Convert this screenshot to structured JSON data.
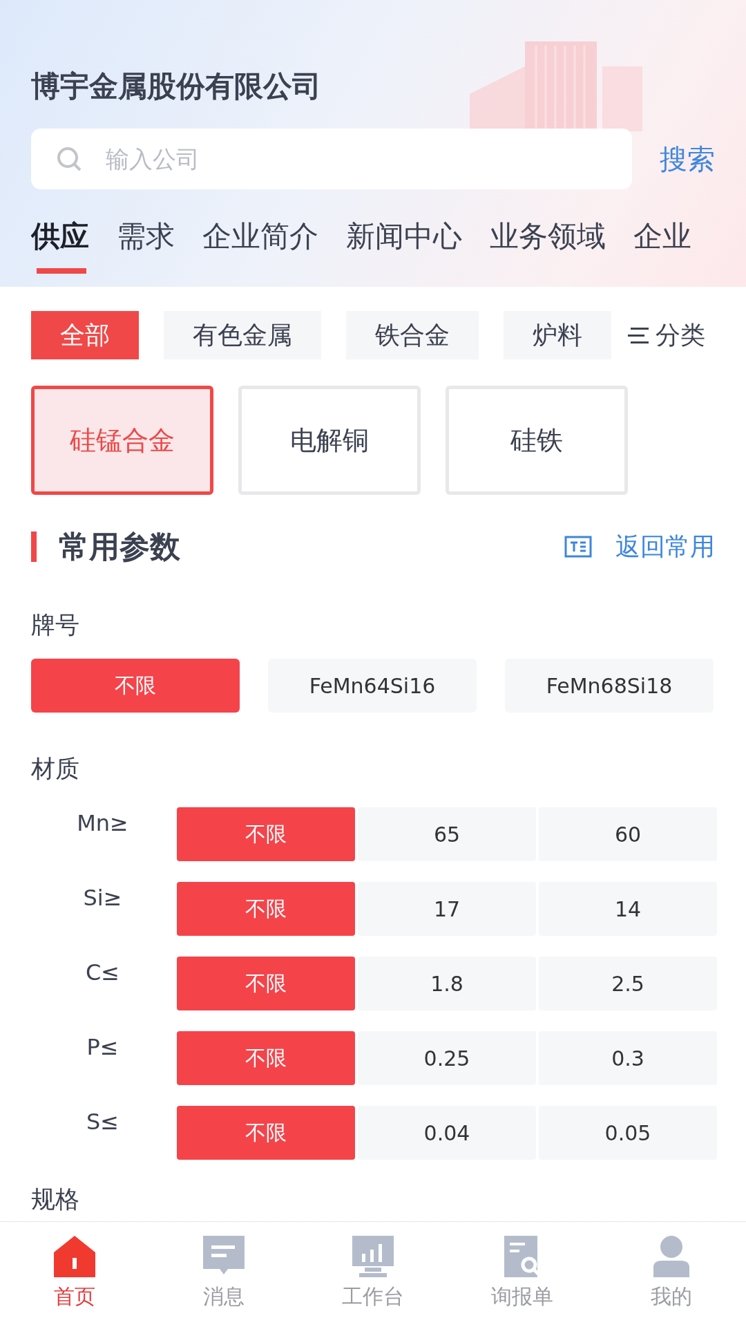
{
  "header": {
    "company": "博宇金属股份有限公司",
    "search": {
      "placeholder": "输入公司",
      "button": "搜索"
    }
  },
  "tabs": [
    {
      "label": "供应",
      "selected": true
    },
    {
      "label": "需求",
      "selected": false
    },
    {
      "label": "企业简介",
      "selected": false
    },
    {
      "label": "新闻中心",
      "selected": false
    },
    {
      "label": "业务领域",
      "selected": false
    },
    {
      "label": "企业",
      "selected": false
    }
  ],
  "categories": [
    {
      "label": "全部",
      "selected": true
    },
    {
      "label": "有色金属",
      "selected": false
    },
    {
      "label": "铁合金",
      "selected": false
    },
    {
      "label": "炉料",
      "selected": false
    }
  ],
  "category_button": "分类",
  "products": [
    {
      "label": "硅锰合金",
      "selected": true
    },
    {
      "label": "电解铜",
      "selected": false
    },
    {
      "label": "硅铁",
      "selected": false
    }
  ],
  "section": {
    "title": "常用参数",
    "action": "返回常用"
  },
  "brand": {
    "label": "牌号",
    "options": [
      {
        "label": "不限",
        "selected": true
      },
      {
        "label": "FeMn64Si16",
        "selected": false
      },
      {
        "label": "FeMn68Si18",
        "selected": false
      }
    ]
  },
  "material": {
    "label": "材质",
    "rows": [
      {
        "name": "Mn≥",
        "options": [
          {
            "label": "不限",
            "selected": true
          },
          {
            "label": "65",
            "selected": false
          },
          {
            "label": "60",
            "selected": false
          }
        ]
      },
      {
        "name": "Si≥",
        "options": [
          {
            "label": "不限",
            "selected": true
          },
          {
            "label": "17",
            "selected": false
          },
          {
            "label": "14",
            "selected": false
          }
        ]
      },
      {
        "name": "C≤",
        "options": [
          {
            "label": "不限",
            "selected": true
          },
          {
            "label": "1.8",
            "selected": false
          },
          {
            "label": "2.5",
            "selected": false
          }
        ]
      },
      {
        "name": "P≤",
        "options": [
          {
            "label": "不限",
            "selected": true
          },
          {
            "label": "0.25",
            "selected": false
          },
          {
            "label": "0.3",
            "selected": false
          }
        ]
      },
      {
        "name": "S≤",
        "options": [
          {
            "label": "不限",
            "selected": true
          },
          {
            "label": "0.04",
            "selected": false
          },
          {
            "label": "0.05",
            "selected": false
          }
        ]
      }
    ]
  },
  "spec": {
    "label": "规格"
  },
  "bottom_nav": [
    {
      "label": "首页",
      "kind": "home",
      "selected": true
    },
    {
      "label": "消息",
      "kind": "message",
      "selected": false
    },
    {
      "label": "工作台",
      "kind": "workbench",
      "selected": false
    },
    {
      "label": "询报单",
      "kind": "inquiry",
      "selected": false
    },
    {
      "label": "我的",
      "kind": "profile",
      "selected": false
    }
  ]
}
